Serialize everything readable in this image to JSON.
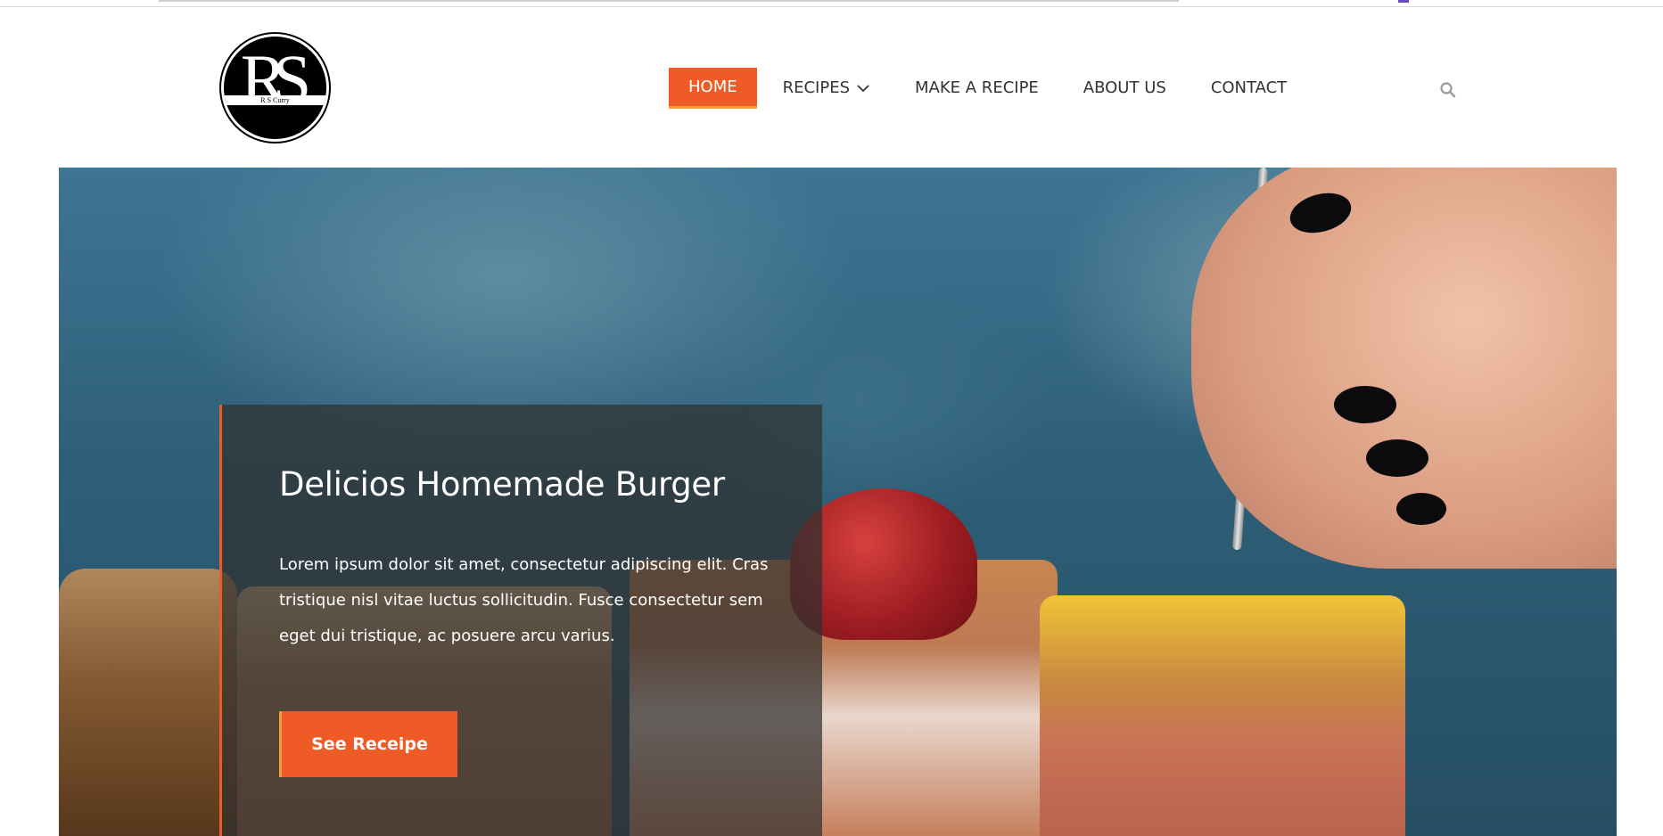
{
  "brand": {
    "logo_letters": "RS",
    "logo_small_text": "R S Curry"
  },
  "nav": {
    "items": [
      {
        "label": "HOME",
        "active": true
      },
      {
        "label": "RECIPES",
        "has_dropdown": true,
        "dropdown_icon": "chevron-down-icon"
      },
      {
        "label": "MAKE A RECIPE"
      },
      {
        "label": "ABOUT US"
      },
      {
        "label": "CONTACT"
      }
    ],
    "search_icon": "search-icon"
  },
  "hero": {
    "title": "Delicios Homemade Burger",
    "text": "Lorem ipsum dolor sit amet, consectetur adipiscing elit. Cras tristique nisl vitae luctus sollicitudin. Fusce consectetur sem eget dui tristique, ac posuere arcu varius.",
    "button_label": "See Receipe"
  },
  "colors": {
    "accent": "#ee5b27",
    "accent_border": "#f2a13a",
    "nav_text": "#333333",
    "caption_bg": "rgba(48,48,48,0.72)"
  }
}
